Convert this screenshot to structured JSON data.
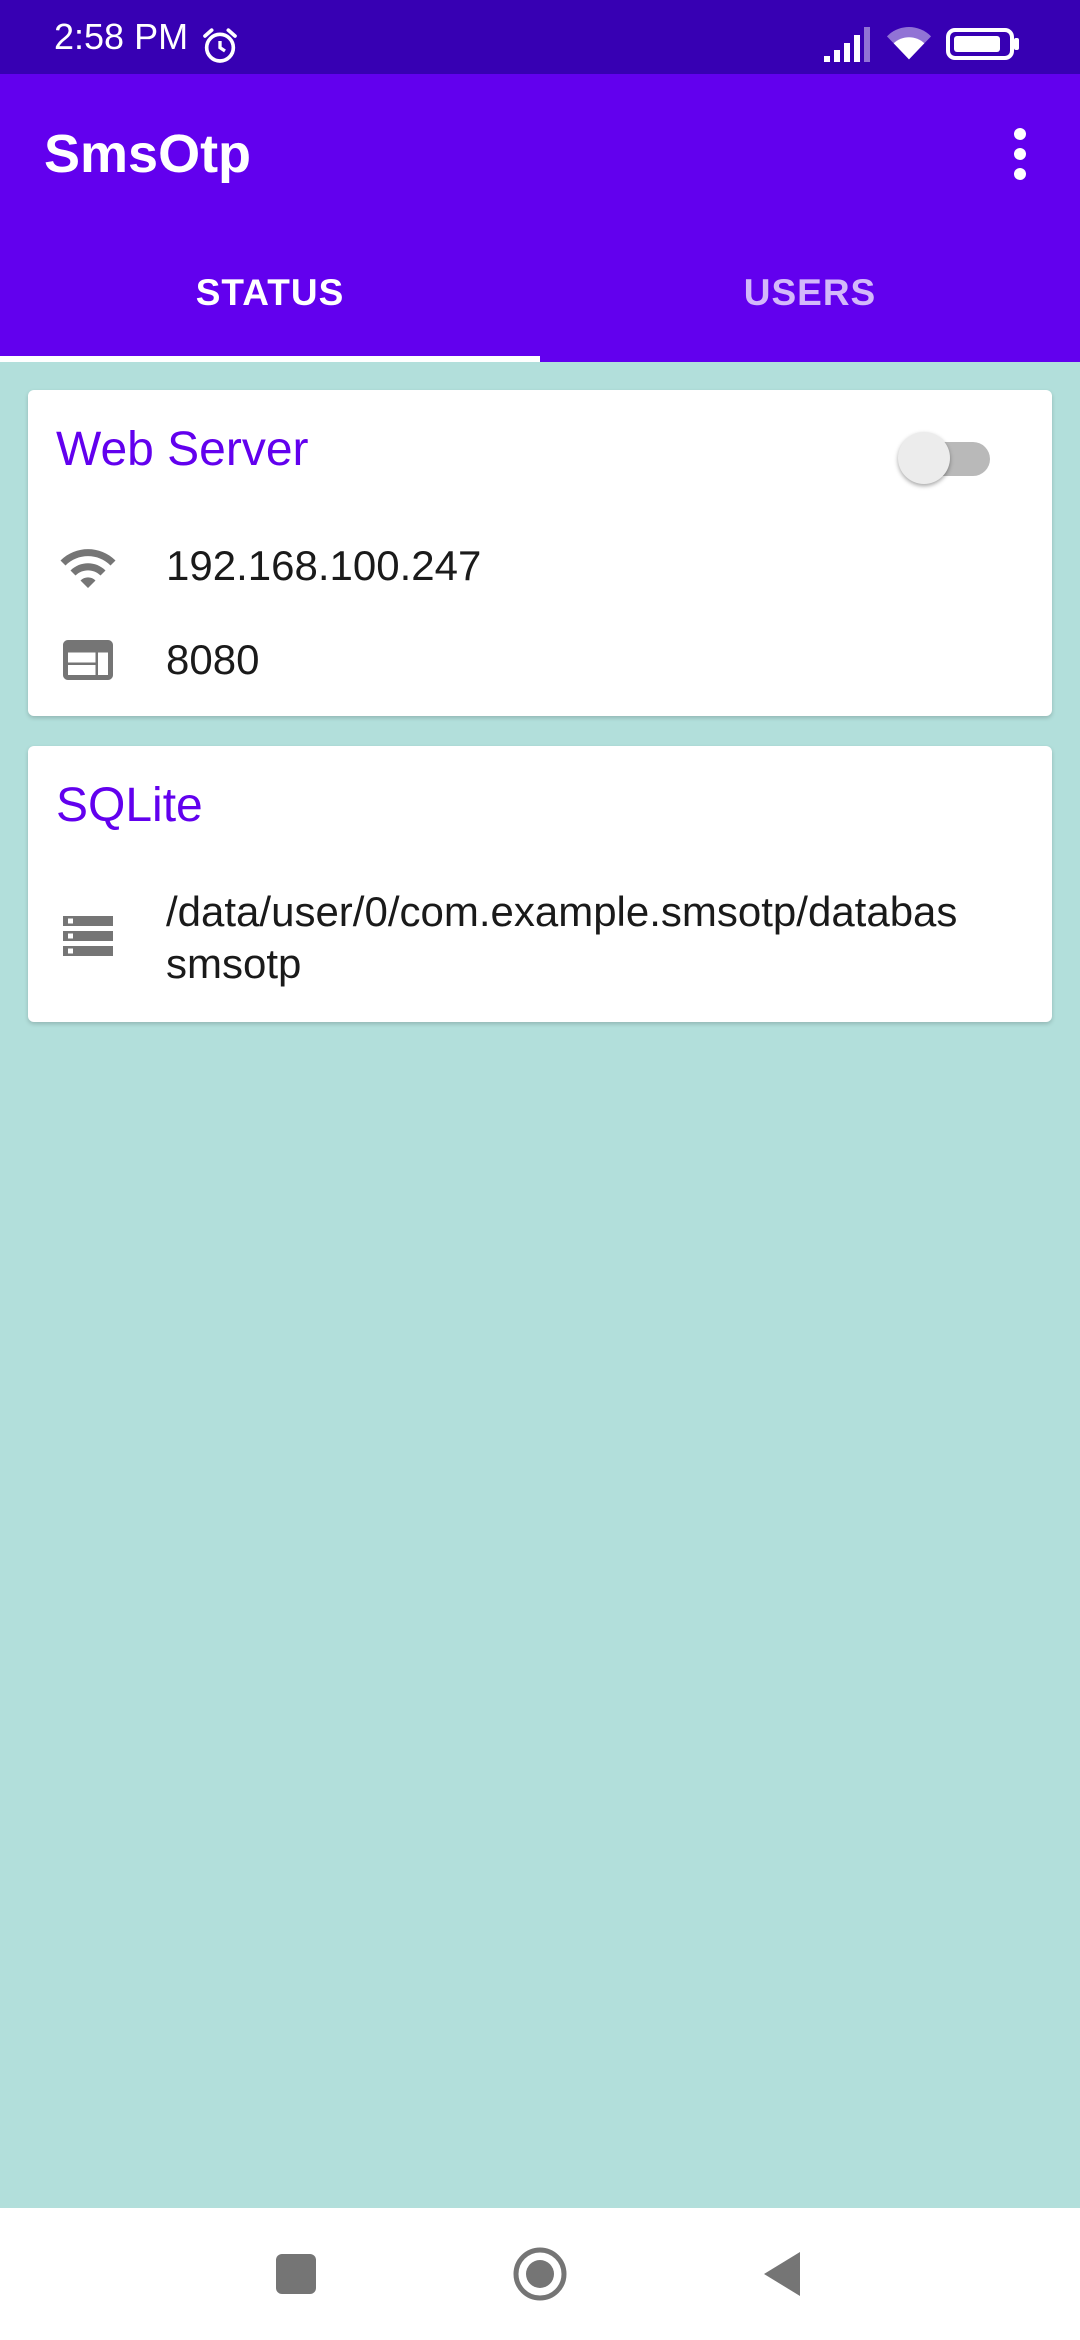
{
  "status_bar": {
    "time": "2:58 PM",
    "icons": [
      "alarm-icon",
      "signal-icon",
      "wifi-icon",
      "battery-icon"
    ]
  },
  "app_bar": {
    "title": "SmsOtp",
    "overflow_icon": "more-vert-icon"
  },
  "tabs": [
    {
      "label": "STATUS",
      "selected": true
    },
    {
      "label": "USERS",
      "selected": false
    }
  ],
  "web_server": {
    "title": "Web Server",
    "enabled": false,
    "ip_icon": "wifi-icon",
    "ip": "192.168.100.247",
    "port_icon": "web-icon",
    "port": "8080"
  },
  "sqlite": {
    "title": "SQLite",
    "db_icon": "storage-icon",
    "path_line1": "/data/user/0/com.example.smsotp/databas",
    "path_line2": "smsotp"
  },
  "nav_bar": {
    "icons": [
      "recents-icon",
      "home-icon",
      "back-icon"
    ]
  },
  "colors": {
    "primary": "#6200ee",
    "primary_dark": "#3700b3",
    "background": "#b2dfdb",
    "card": "#ffffff",
    "icon_gray": "#757575"
  }
}
